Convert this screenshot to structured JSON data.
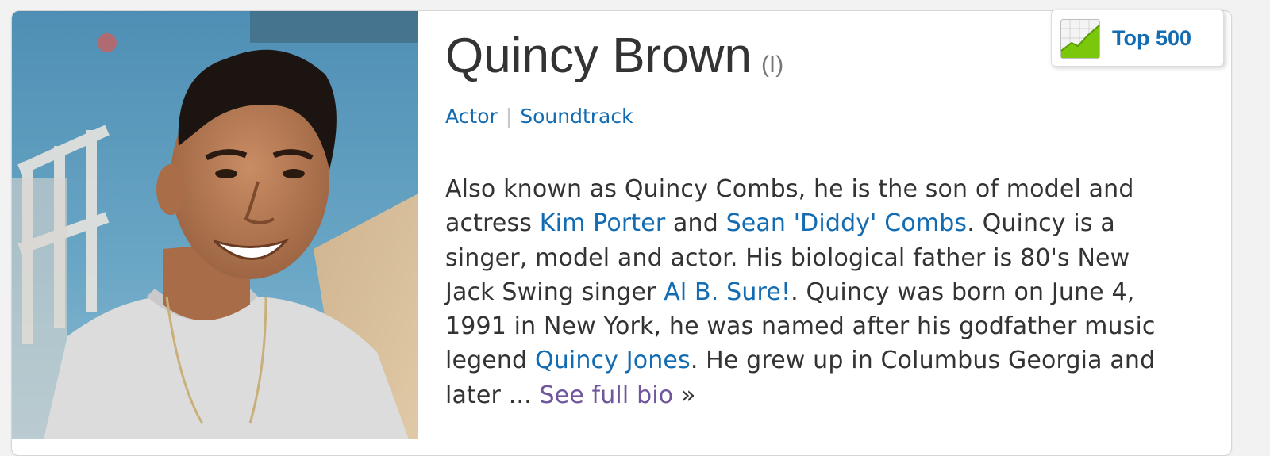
{
  "person": {
    "name": "Quincy Brown",
    "disambiguation": "(I)",
    "photo_alt": "Quincy Brown"
  },
  "jobs": {
    "items": [
      "Actor",
      "Soundtrack"
    ],
    "separator": "|"
  },
  "rank_badge": {
    "label": "Top 500",
    "icon": "rising-chart-icon"
  },
  "bio": {
    "lines": [
      {
        "t1": "Also known as Quincy Combs, he is the son of model and"
      },
      {
        "t1": "actress ",
        "link1": "Kim Porter",
        "t2": " and ",
        "link2": "Sean 'Diddy' Combs",
        "t3": ". Quincy is a"
      },
      {
        "t1": "singer, model and actor. His biological father is 80's New"
      },
      {
        "t1": "Jack Swing singer ",
        "link1": "Al B. Sure!",
        "t2": ". Quincy was born on June 4,"
      },
      {
        "t1": "1991 in New York, he was named after his godfather music"
      },
      {
        "t1": "legend ",
        "link1": "Quincy Jones",
        "t2": ". He grew up in Columbus Georgia and"
      },
      {
        "t1": "later ... ",
        "more": "See full bio",
        "arrow": " »"
      }
    ]
  },
  "colors": {
    "link": "#136cb2",
    "visited_link": "#70579d",
    "text": "#333333",
    "badge_green": "#7ac70c"
  }
}
